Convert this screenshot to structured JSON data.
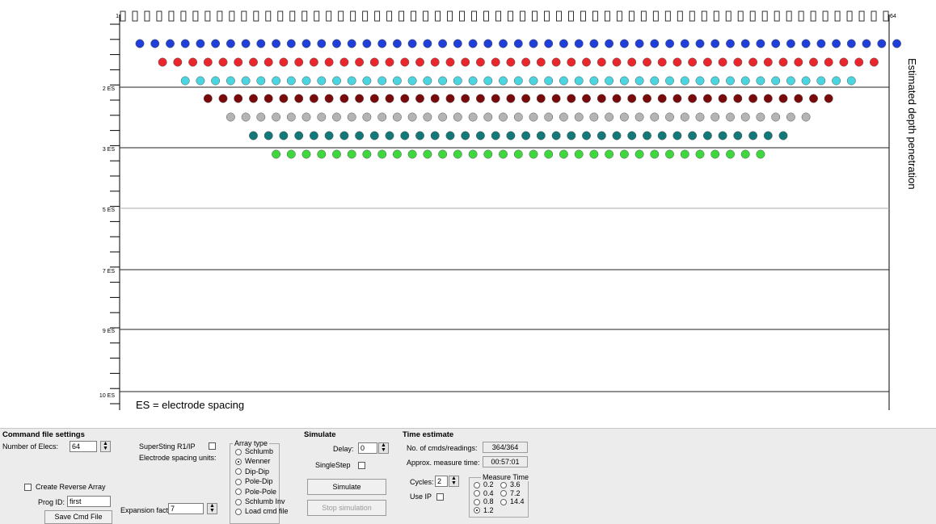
{
  "plot": {
    "electrode_first": "1",
    "electrode_last": "64",
    "electrode_count": 64,
    "depth_labels": [
      "2 ES",
      "3 ES",
      "5 ES",
      "7 ES",
      "9 ES",
      "10 ES"
    ],
    "right_label": "Estimated depth penetration",
    "legend_note": "ES = electrode spacing",
    "levels": [
      {
        "color": "#1f3fd8",
        "points": 51
      },
      {
        "color": "#e8262b",
        "points": 48
      },
      {
        "color": "#4ad6e0",
        "points": 45
      },
      {
        "color": "#7a0a0a",
        "points": 42
      },
      {
        "color": "#b4b4b4",
        "points": 39
      },
      {
        "color": "#127878",
        "points": 36
      },
      {
        "color": "#3ed83e",
        "points": 33
      }
    ]
  },
  "command_file": {
    "title": "Command file settings",
    "num_elecs_label": "Number of Elecs:",
    "num_elecs_value": "64",
    "superstring_label": "SuperSting R1/IP",
    "electrode_spacing_label": "Electrode spacing units:",
    "reverse_array_label": "Create Reverse Array",
    "prog_id_label": "Prog ID:",
    "prog_id_value": "first",
    "expansion_label": "Expansion factor",
    "expansion_value": "7",
    "save_button": "Save Cmd File"
  },
  "array_type": {
    "legend": "Array type",
    "options": [
      "Schlumb",
      "Wenner",
      "Dip-Dip",
      "Pole-Dip",
      "Pole-Pole",
      "Schlumb Inv",
      "Load cmd file"
    ],
    "selected": "Wenner"
  },
  "simulate": {
    "title": "Simulate",
    "delay_label": "Delay:",
    "delay_value": "0",
    "singlestep_label": "SingleStep",
    "simulate_button": "Simulate",
    "stop_button": "Stop simulation"
  },
  "time_estimate": {
    "title": "Time estimate",
    "cmds_label": "No. of cmds/readings:",
    "cmds_value": "364/364",
    "approx_label": "Approx. measure time:",
    "approx_value": "00:57:01",
    "cycles_label": "Cycles:",
    "cycles_value": "2",
    "use_ip_label": "Use IP",
    "measure_time_legend": "Measure Time",
    "measure_options": [
      "0.2",
      "3.6",
      "0.4",
      "7.2",
      "0.8",
      "14.4",
      "1.2"
    ],
    "measure_selected": "1.2"
  }
}
